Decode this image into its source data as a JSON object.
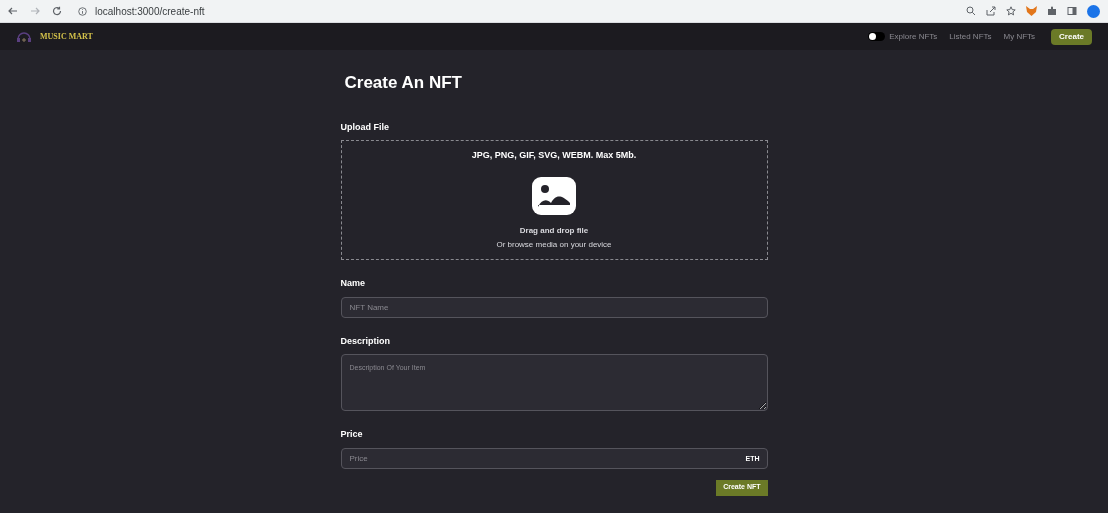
{
  "browser": {
    "url": "localhost:3000/create-nft"
  },
  "nav": {
    "logo": "MUSIC MART",
    "theme_toggle": {
      "on": false
    },
    "links": [
      "Explore NFTs",
      "Listed NFTs",
      "My NFTs"
    ],
    "create_button": "Create"
  },
  "page": {
    "title": "Create An NFT",
    "upload": {
      "label": "Upload File",
      "formats": "JPG, PNG, GIF, SVG, WEBM. Max 5Mb.",
      "drag_text": "Drag and drop file",
      "browse_text": "Or browse media on your device"
    },
    "fields": [
      {
        "kind": "input",
        "label": "Name",
        "placeholder": "NFT Name"
      },
      {
        "kind": "textarea",
        "label": "Description",
        "placeholder": "Description Of Your Item"
      },
      {
        "kind": "input",
        "label": "Price",
        "placeholder": "Price",
        "suffix": "ETH"
      }
    ],
    "submit": "Create NFT"
  }
}
